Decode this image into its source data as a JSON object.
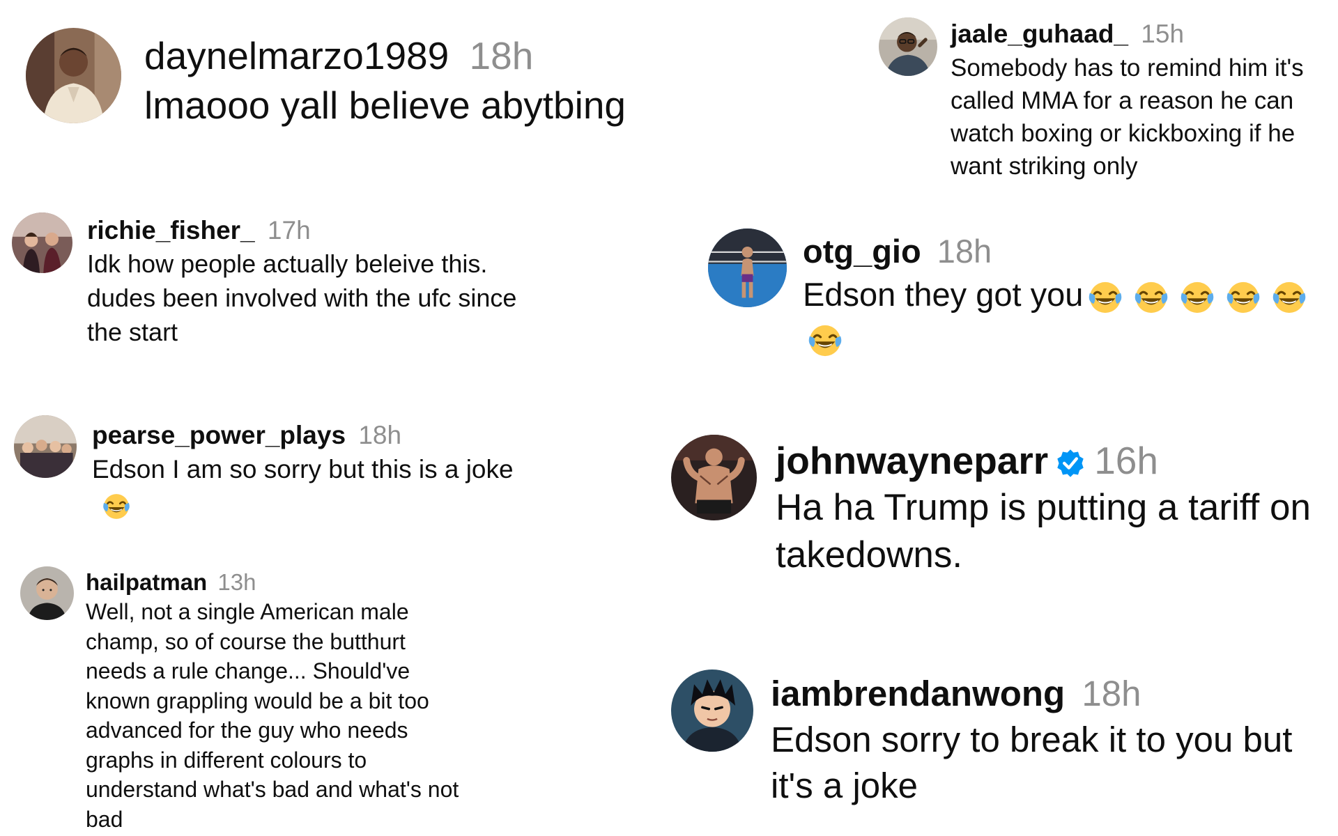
{
  "comments": [
    {
      "username": "daynelmarzo1989",
      "time": "18h",
      "text": "lmaooo yall believe abytbing",
      "avatar": "avatar-man-in-suit"
    },
    {
      "username": "jaale_guhaad_",
      "time": "15h",
      "text": "Somebody has to remind him it's called MMA for a reason he can watch boxing or kickboxing if he want striking only",
      "avatar": "avatar-man-with-glasses"
    },
    {
      "username": "richie_fisher_",
      "time": "17h",
      "text": "Idk how people actually beleive this. dudes been involved with the ufc since the start",
      "avatar": "avatar-group-photo"
    },
    {
      "username": "otg_gio",
      "time": "18h",
      "text": "Edson they got you",
      "emoji": "face-with-tears-of-joy",
      "emoji_count": 6,
      "avatar": "avatar-boxing-ring"
    },
    {
      "username": "pearse_power_plays",
      "time": "18h",
      "text": "Edson I am so sorry but this is a joke",
      "emoji": "face-with-tears-of-joy",
      "emoji_count": 1,
      "avatar": "avatar-group-photo"
    },
    {
      "username": "johnwayneparr",
      "time": "16h",
      "verified": true,
      "text": "Ha ha Trump is putting a tariff on takedowns.",
      "avatar": "avatar-fighter"
    },
    {
      "username": "hailpatman",
      "time": "13h",
      "text": "Well, not a single American male champ, so of course the butthurt needs a rule change... Should've known grappling would be a bit too advanced for the guy who needs graphs in different colours to understand what's bad and what's not bad",
      "avatar": "avatar-man-portrait"
    },
    {
      "username": "iambrendanwong",
      "time": "18h",
      "text": "Edson sorry to break it to you but it's a joke",
      "avatar": "avatar-anime-character"
    }
  ],
  "colors": {
    "text": "#0f0f0f",
    "meta": "#8e8e8e",
    "verified": "#0095f6",
    "background": "#ffffff"
  }
}
